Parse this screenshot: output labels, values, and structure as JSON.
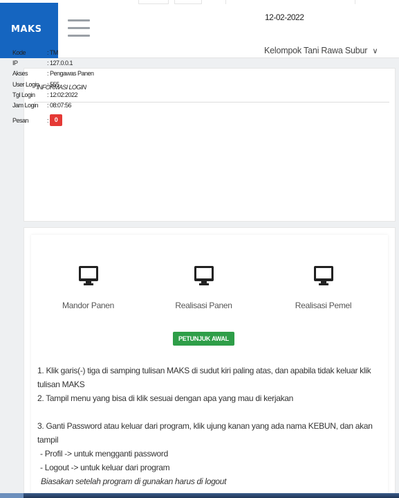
{
  "header": {
    "brand": "MAKS",
    "date": "12-02-2022",
    "group_name": "Kelompok Tani Rawa Subur",
    "group_chevron": "∨"
  },
  "login_info": {
    "title": "INFORMASI LOGIN",
    "rows": [
      {
        "label": "Kode",
        "value": ": TM"
      },
      {
        "label": "IP",
        "value": ": 127.0.0.1"
      },
      {
        "label": "Akses",
        "value": ": Pengawas Panen"
      },
      {
        "label": "User Login",
        "value": ": 555"
      },
      {
        "label": "Tgl Login",
        "value": ": 12:02:2022"
      },
      {
        "label": "Jam Login",
        "value": ": 08:07:56"
      }
    ],
    "pesan_label": "Pesan",
    "pesan_sep": ":",
    "pesan_count": "0"
  },
  "menu": {
    "items": [
      {
        "label": "Mandor Panen",
        "icon": "monitor-icon"
      },
      {
        "label": "Realisasi Panen",
        "icon": "monitor-icon"
      },
      {
        "label": "Realisasi Pemel",
        "icon": "monitor-icon"
      }
    ]
  },
  "petunjuk": {
    "button": "PETUNJUK AWAL",
    "lines": [
      "1. Klik garis(-) tiga di samping tulisan MAKS di sudut kiri paling atas, dan apabila tidak keluar klik tulisan MAKS",
      "2. Tampil menu yang bisa di klik sesuai dengan apa yang mau di kerjakan",
      "3. Ganti Password atau keluar dari program, klik ujung kanan yang ada nama KEBUN, dan akan tampil",
      " - Profil -> untuk mengganti password",
      " - Logout -> untuk keluar dari program",
      "Biasakan setelah program di gunakan harus di logout"
    ]
  },
  "colors": {
    "brand": "#1565c0",
    "badge": "#e53935",
    "button": "#2e9e48"
  }
}
